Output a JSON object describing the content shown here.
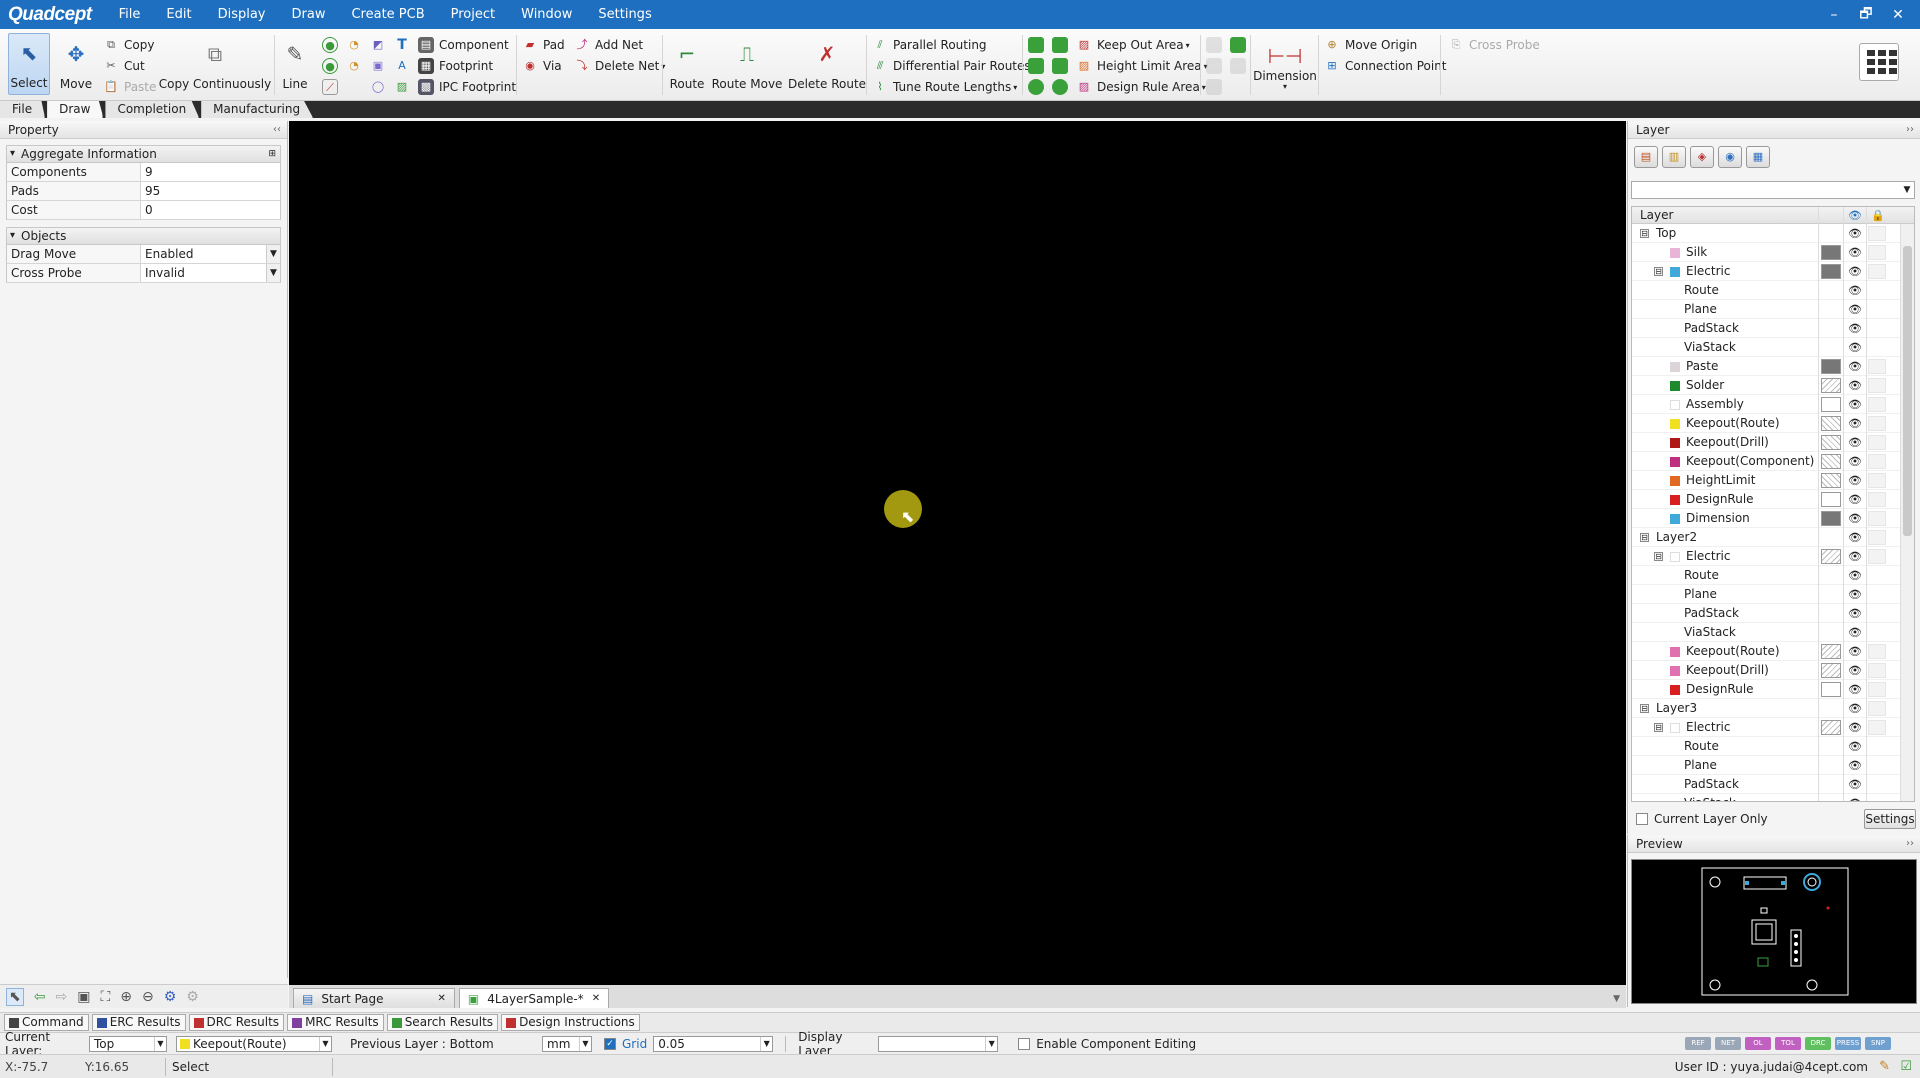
{
  "app": {
    "logo": "Quadcept"
  },
  "menu": [
    "File",
    "Edit",
    "Display",
    "Draw",
    "Create PCB",
    "Project",
    "Window",
    "Settings"
  ],
  "window_controls": [
    "–",
    "🗗",
    "✕"
  ],
  "ribbon": {
    "select": "Select",
    "move": "Move",
    "copy": "Copy",
    "cut": "Cut",
    "paste": "Paste",
    "copy_continuously": "Copy Continuously",
    "line": "Line",
    "component": "Component",
    "footprint": "Footprint",
    "ipc_footprint": "IPC Footprint",
    "pad": "Pad",
    "via": "Via",
    "add_net": "Add Net",
    "delete_net": "Delete Net",
    "route": "Route",
    "route_move": "Route Move",
    "delete_route": "Delete Route",
    "parallel_routing": "Parallel Routing",
    "differential_pair_routes": "Differential Pair Routes",
    "tune_route_lengths": "Tune Route Lengths",
    "keep_out_area": "Keep Out Area",
    "height_limit_area": "Height Limit Area",
    "design_rule_area": "Design Rule Area",
    "dimension": "Dimension",
    "move_origin": "Move Origin",
    "connection_point": "Connection Point",
    "cross_probe": "Cross Probe"
  },
  "ribbon_tabs": [
    "File",
    "Draw",
    "Completion",
    "Manufacturing"
  ],
  "property": {
    "title": "Property",
    "aggregate": {
      "title": "Aggregate Information",
      "rows": [
        {
          "key": "Components",
          "value": "9"
        },
        {
          "key": "Pads",
          "value": "95"
        },
        {
          "key": "Cost",
          "value": "0"
        }
      ]
    },
    "objects": {
      "title": "Objects",
      "rows": [
        {
          "key": "Drag Move",
          "value": "Enabled"
        },
        {
          "key": "Cross Probe",
          "value": "Invalid"
        }
      ]
    }
  },
  "layer_panel": {
    "title": "Layer",
    "column_header": "Layer",
    "rows": [
      {
        "name": "Top",
        "level": 0,
        "toggle": "⊟",
        "swatch": "",
        "box": ""
      },
      {
        "name": "Silk",
        "level": 2,
        "toggle": "",
        "swatch": "#e8b4d8",
        "box": "#777777"
      },
      {
        "name": "Electric",
        "level": 1,
        "toggle": "⊟",
        "swatch": "#3fa9d9",
        "box": "#777777"
      },
      {
        "name": "Route",
        "level": 2,
        "toggle": "",
        "swatch": "",
        "box": ""
      },
      {
        "name": "Plane",
        "level": 2,
        "toggle": "",
        "swatch": "",
        "box": ""
      },
      {
        "name": "PadStack",
        "level": 2,
        "toggle": "",
        "swatch": "",
        "box": ""
      },
      {
        "name": "ViaStack",
        "level": 2,
        "toggle": "",
        "swatch": "",
        "box": ""
      },
      {
        "name": "Paste",
        "level": 2,
        "toggle": "",
        "swatch": "#dcd4d8",
        "box": "#777777"
      },
      {
        "name": "Solder",
        "level": 2,
        "toggle": "",
        "swatch": "#1e8a2e",
        "box": "hatch"
      },
      {
        "name": "Assembly",
        "level": 2,
        "toggle": "",
        "swatch": "#ffffff",
        "box": "#ffffff"
      },
      {
        "name": "Keepout(Route)",
        "level": 2,
        "toggle": "",
        "swatch": "#f0e020",
        "box": "cross"
      },
      {
        "name": "Keepout(Drill)",
        "level": 2,
        "toggle": "",
        "swatch": "#b01818",
        "box": "cross"
      },
      {
        "name": "Keepout(Component)",
        "level": 2,
        "toggle": "",
        "swatch": "#c03080",
        "box": "cross"
      },
      {
        "name": "HeightLimit",
        "level": 2,
        "toggle": "",
        "swatch": "#e06820",
        "box": "cross"
      },
      {
        "name": "DesignRule",
        "level": 2,
        "toggle": "",
        "swatch": "#d82020",
        "box": "#ffffff"
      },
      {
        "name": "Dimension",
        "level": 2,
        "toggle": "",
        "swatch": "#3fa9d9",
        "box": "#777777"
      },
      {
        "name": "Layer2",
        "level": 0,
        "toggle": "⊟",
        "swatch": "",
        "box": ""
      },
      {
        "name": "Electric",
        "level": 1,
        "toggle": "⊟",
        "swatch": "#ffffff",
        "box": "hatch"
      },
      {
        "name": "Route",
        "level": 2,
        "toggle": "",
        "swatch": "",
        "box": ""
      },
      {
        "name": "Plane",
        "level": 2,
        "toggle": "",
        "swatch": "",
        "box": ""
      },
      {
        "name": "PadStack",
        "level": 2,
        "toggle": "",
        "swatch": "",
        "box": ""
      },
      {
        "name": "ViaStack",
        "level": 2,
        "toggle": "",
        "swatch": "",
        "box": ""
      },
      {
        "name": "Keepout(Route)",
        "level": 2,
        "toggle": "",
        "swatch": "#e070b0",
        "box": "hatch"
      },
      {
        "name": "Keepout(Drill)",
        "level": 2,
        "toggle": "",
        "swatch": "#e070b0",
        "box": "hatch"
      },
      {
        "name": "DesignRule",
        "level": 2,
        "toggle": "",
        "swatch": "#d82020",
        "box": "#ffffff"
      },
      {
        "name": "Layer3",
        "level": 0,
        "toggle": "⊟",
        "swatch": "",
        "box": ""
      },
      {
        "name": "Electric",
        "level": 1,
        "toggle": "⊟",
        "swatch": "#ffffff",
        "box": "hatch"
      },
      {
        "name": "Route",
        "level": 2,
        "toggle": "",
        "swatch": "",
        "box": ""
      },
      {
        "name": "Plane",
        "level": 2,
        "toggle": "",
        "swatch": "",
        "box": ""
      },
      {
        "name": "PadStack",
        "level": 2,
        "toggle": "",
        "swatch": "",
        "box": ""
      },
      {
        "name": "ViaStack",
        "level": 2,
        "toggle": "",
        "swatch": "",
        "box": ""
      }
    ],
    "current_layer_only": "Current Layer Only",
    "settings": "Settings"
  },
  "preview": {
    "title": "Preview"
  },
  "doc_tabs": [
    {
      "label": "Start Page",
      "close": "✕"
    },
    {
      "label": "4LayerSample-*",
      "close": "✕"
    }
  ],
  "output_tabs": [
    "Command",
    "ERC Results",
    "DRC Results",
    "MRC Results",
    "Search Results",
    "Design Instructions"
  ],
  "status": {
    "current_layer_label": "Current Layer:",
    "current_layer": "Top",
    "sub_layer": "Keepout(Route)",
    "previous_layer": "Previous Layer : Bottom",
    "unit": "mm",
    "grid_label": "Grid",
    "grid_value": "0.05",
    "display_layer_label": "Display Layer",
    "display_layer": "",
    "enable_component_editing": "Enable Component Editing",
    "x": "X:-75.7",
    "y": "Y:16.65",
    "mode": "Select",
    "user": "User ID : yuya.judai@4cept.com"
  },
  "colors": {
    "title_bar": "#1e6fbf",
    "canvas": "#000000",
    "cursor_highlight": "#beb414"
  }
}
